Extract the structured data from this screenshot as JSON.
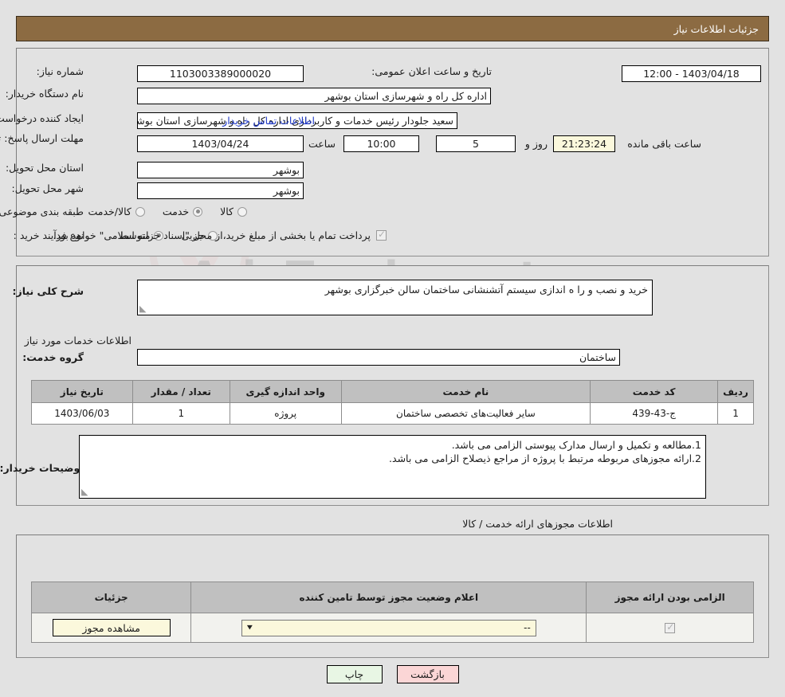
{
  "header": {
    "title": "جزئیات اطلاعات نیاز"
  },
  "watermark": {
    "text": "AriaTender.net"
  },
  "top_section": {
    "need_number_label": "شماره نیاز:",
    "need_number_value": "1103003389000020",
    "announce_label": "تاریخ و ساعت اعلان عمومی:",
    "announce_value": "1403/04/18 - 12:00",
    "buyer_org_label": "نام دستگاه خریدار:",
    "buyer_org_value": "اداره کل راه و شهرسازی استان بوشهر",
    "creator_label": "ایجاد کننده درخواست:",
    "creator_value": "سعید جلودار رئیس خدمات و کاربردازی اداره کل راه و شهرسازی استان بوشهر",
    "contact_link": "اطلاعات تماس خریدار",
    "deadline_label": "مهلت ارسال پاسخ: تا تاریخ:",
    "deadline_date": "1403/04/24",
    "deadline_hour_label": "ساعت",
    "deadline_hour": "10:00",
    "remaining_days": "5",
    "remaining_days_label": "روز و",
    "remaining_time": "21:23:24",
    "remaining_time_label": "ساعت باقی مانده",
    "province_label": "استان محل تحویل:",
    "province_value": "بوشهر",
    "city_label": "شهر محل تحویل:",
    "city_value": "بوشهر",
    "category_label": "طبقه بندی موضوعی:",
    "category_options": [
      {
        "label": "کالا",
        "selected": false
      },
      {
        "label": "خدمت",
        "selected": true
      },
      {
        "label": "کالا/خدمت",
        "selected": false
      }
    ],
    "process_label": "نوع فرآیند خرید :",
    "process_options": [
      {
        "label": "جزیی",
        "selected": false
      },
      {
        "label": "متوسط",
        "selected": true
      }
    ],
    "treasury_checked": true,
    "treasury_note": "پرداخت تمام یا بخشی از مبلغ خرید،از محل \"اسناد خزانه اسلامی\" خواهد بود."
  },
  "mid_section": {
    "summary_label": "شرح کلی نیاز:",
    "summary_value": "خرید و نصب و را ه اندازی سیستم آتشنشانی ساختمان سالن خبرگزاری بوشهر",
    "services_title": "اطلاعات خدمات مورد نیاز",
    "service_group_label": "گروه خدمت:",
    "service_group_value": "ساختمان",
    "table": {
      "headers": [
        "ردیف",
        "کد خدمت",
        "نام خدمت",
        "واحد اندازه گیری",
        "تعداد / مقدار",
        "تاریخ نیاز"
      ],
      "rows": [
        [
          "1",
          "ج-43-439",
          "سایر فعالیت‌های تخصصی ساختمان",
          "پروژه",
          "1",
          "1403/06/03"
        ]
      ]
    },
    "notes_label": "توضیحات خریدار:",
    "notes_lines": [
      "1.مطالعه و تکمیل و ارسال مدارک پیوستی الزامی می باشد.",
      "2.ارائه مجوزهای مربوطه مرتبط با پروژه از مراجع ذیصلاح الزامی می باشد."
    ]
  },
  "licenses_section": {
    "title": "اطلاعات مجوزهای ارائه خدمت / کالا",
    "headers": [
      "الزامی بودن ارائه مجوز",
      "اعلام وضعیت مجوز توسط تامین کننده",
      "جزئیات"
    ],
    "row": {
      "required_checked": true,
      "status_value": "--",
      "detail_button": "مشاهده مجوز"
    }
  },
  "footer": {
    "print_label": "چاپ",
    "back_label": "بازگشت"
  },
  "colors": {
    "header_bg": "#8c6b42",
    "page_bg": "#e2e2e2",
    "link": "#1f39c8",
    "table_header_bg": "#c0c0c0",
    "highlight_yellow": "#fbf8dc",
    "print_green": "#e8f6e4",
    "back_pink": "#fbd6d6"
  }
}
